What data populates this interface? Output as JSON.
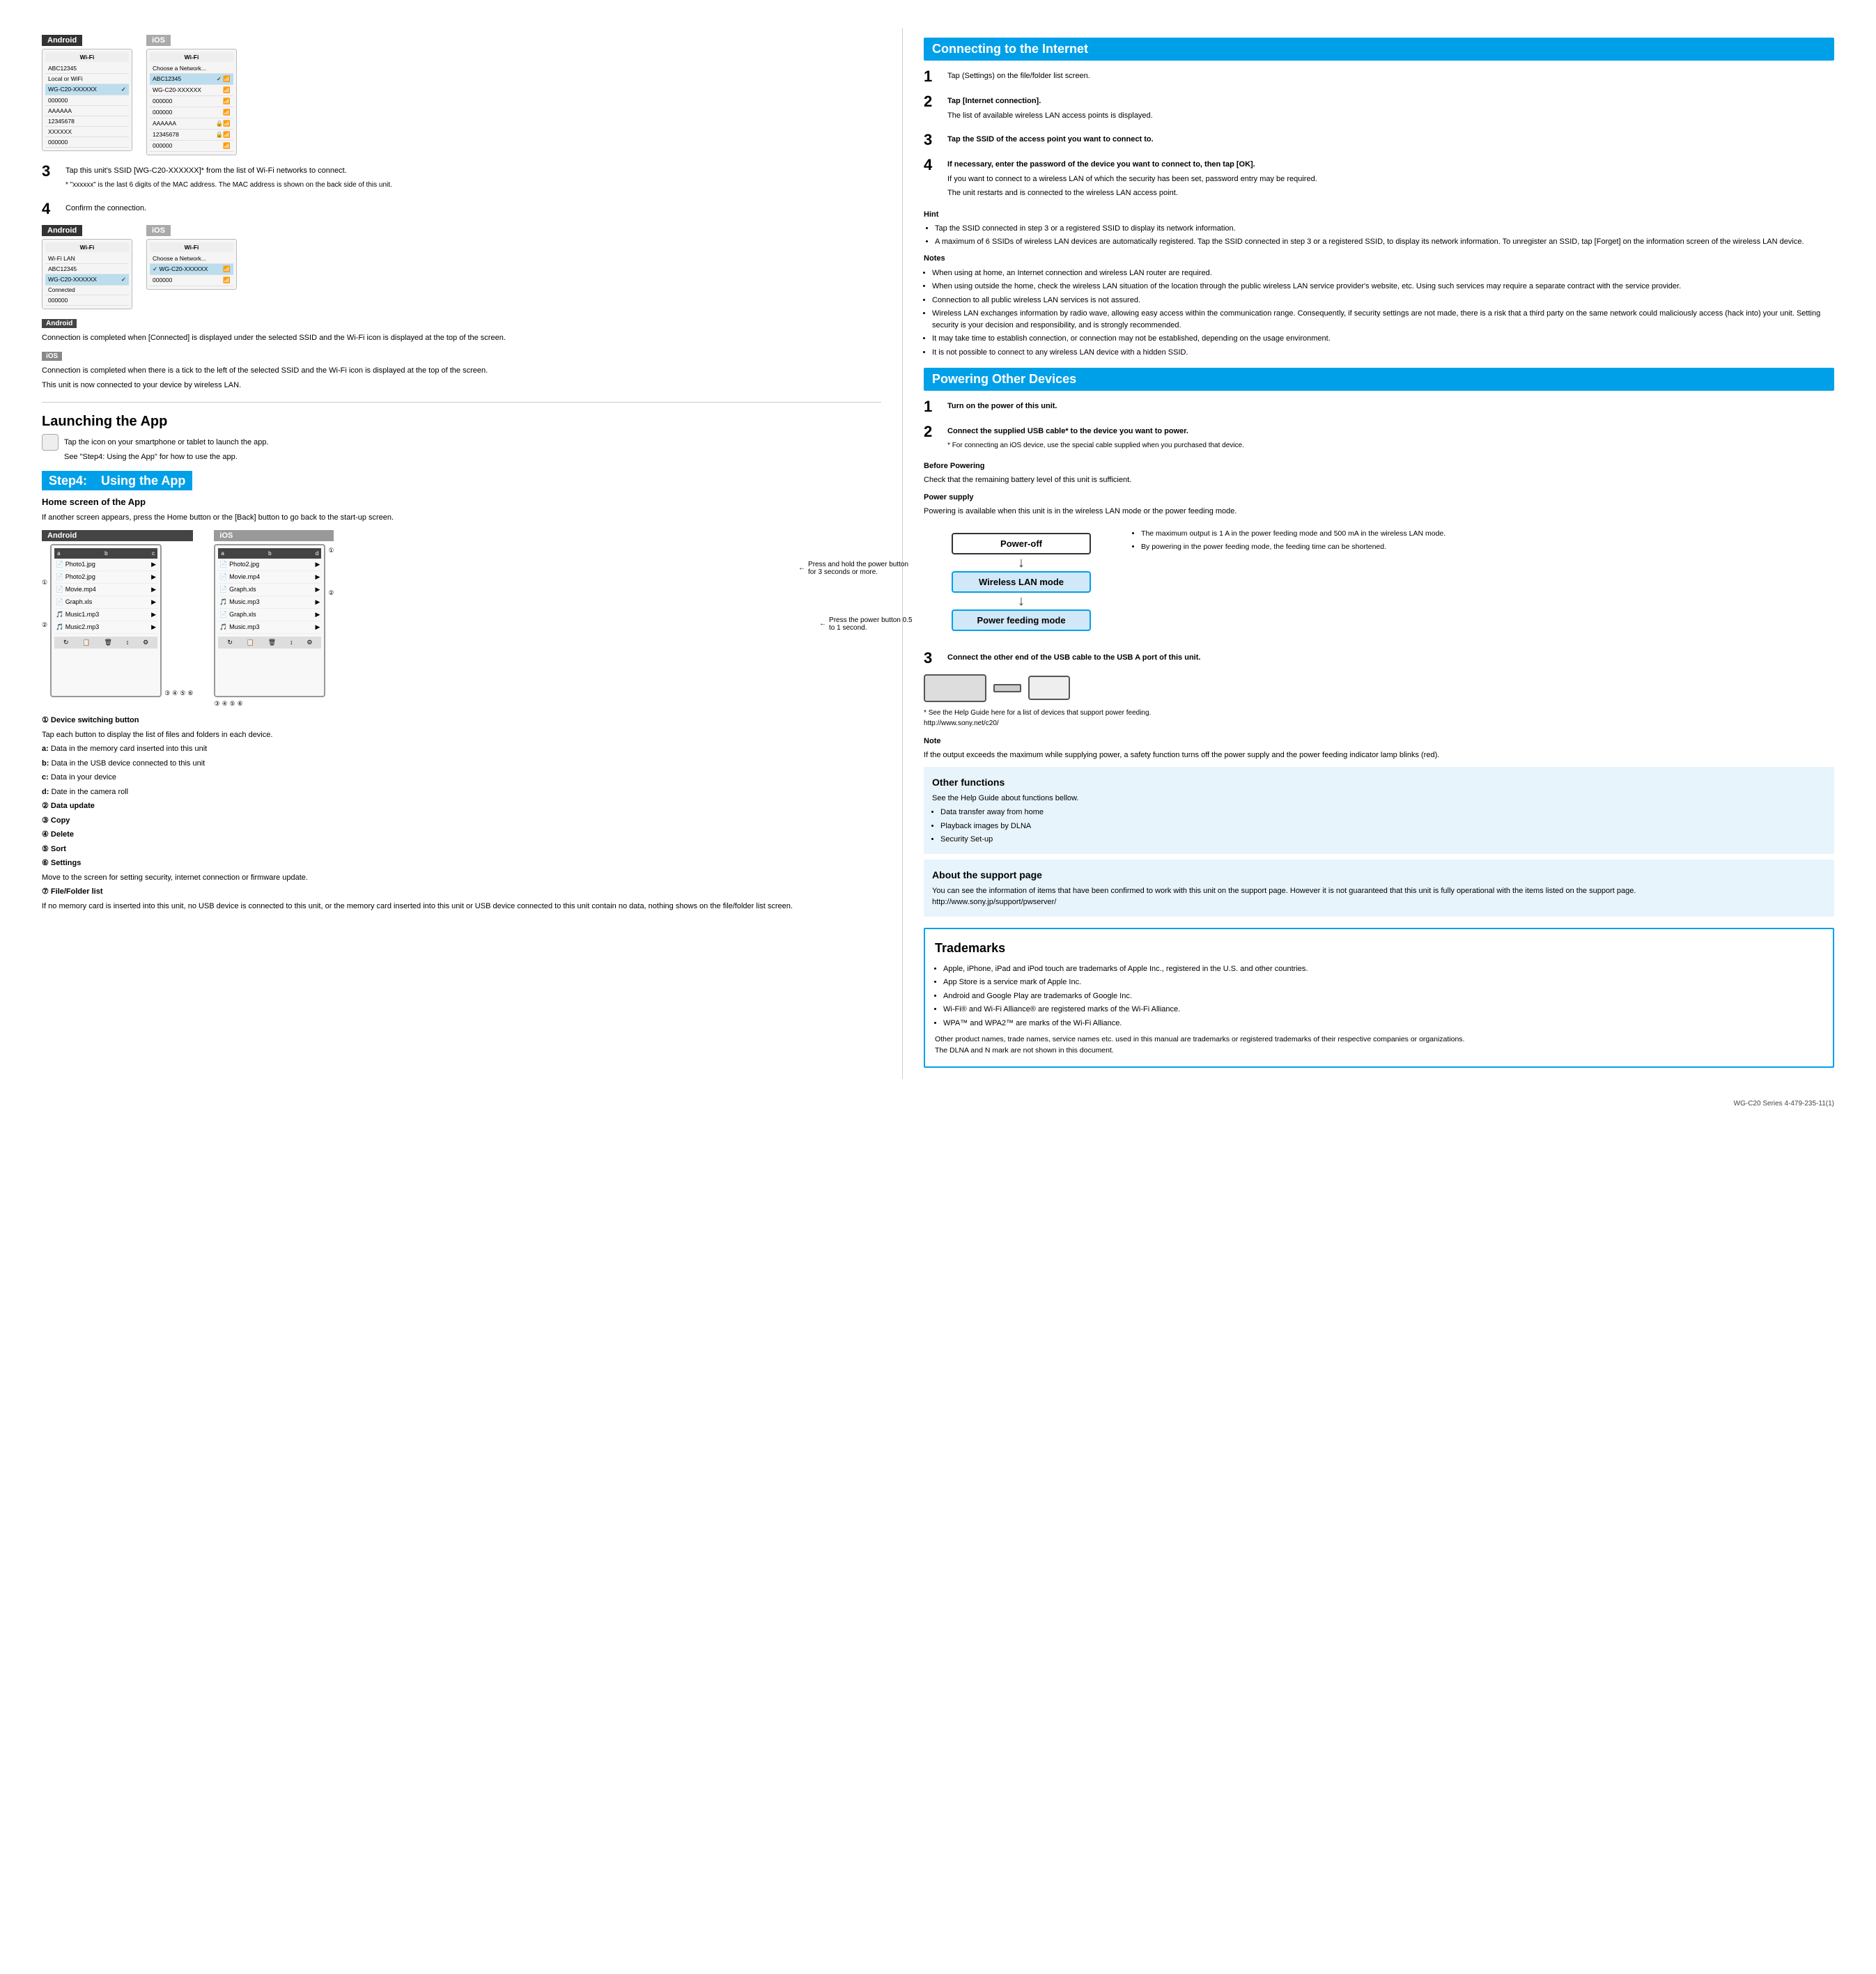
{
  "page": {
    "bottom_note": "WG-C20 Series 4-479-235-11(1)"
  },
  "left_col": {
    "step3_label": "3",
    "step3_text": "Tap this unit's SSID [WG-C20-XXXXXX]* from the list of Wi-Fi networks to connect.",
    "step3_note": "* \"xxxxxx\" is the last 6 digits of the MAC address. The MAC address is shown on the back side of this unit.",
    "step4_label": "4",
    "step4_text": "Confirm the connection.",
    "android_label": "Android",
    "ios_label": "iOS",
    "android_connection_text": "Connection is completed when [Connected] is displayed under the selected SSID and the Wi-Fi icon is displayed at the top of the screen.",
    "ios_connection_text": "Connection is completed when there is a tick to the left of the selected SSID and the Wi-Fi icon is displayed at the top of the screen.",
    "ios_connection_text2": "This unit is now connected to your device by wireless LAN.",
    "launching_header": "Launching the App",
    "launching_text": "Tap the icon on your smartphone or tablet to launch the app.",
    "launching_see": "See \"Step4: Using the App\" for how to use the app.",
    "step4_box_label": "Step4:",
    "step4_box_title": "Using the App",
    "home_screen_label": "Home screen of the App",
    "home_screen_text": "If another screen appears, press the Home button or the [Back] button to go back to the start-up screen.",
    "android_label2": "Android",
    "ios_label2": "iOS",
    "legend_items": [
      {
        "num": "①",
        "label": "Device switching button",
        "detail": "Tap each button to display the list of files and folders in each device.\na: Data in the memory card inserted into this unit\nb: Data in the USB device connected to this unit\nc: Data in your device\nd: Date in the camera roll"
      },
      {
        "num": "②",
        "label": "Data update"
      },
      {
        "num": "③",
        "label": "Copy"
      },
      {
        "num": "④",
        "label": "Delete"
      },
      {
        "num": "⑤",
        "label": "Sort"
      },
      {
        "num": "⑥",
        "label": "Settings",
        "detail": "Move to the screen for setting security, internet connection or firmware update."
      },
      {
        "num": "⑦",
        "label": "File/Folder list",
        "detail": "If no memory card is inserted into this unit, no USB device is connected to this unit, or the memory card inserted into this unit or USB device connected to this unit contain no data, nothing shows on the file/folder list screen."
      }
    ]
  },
  "right_col": {
    "connecting_header": "Connecting to the Internet",
    "step1_label": "1",
    "step1_text": "Tap (Settings) on the file/folder list screen.",
    "step2_label": "2",
    "step2_text": "Tap [Internet connection].",
    "step2_detail": "The list of available wireless LAN access points is displayed.",
    "step3_label": "3",
    "step3_text": "Tap the SSID of the access point you want to connect to.",
    "step4_label": "4",
    "step4_text": "If necessary, enter the password of the device you want to connect to, then tap [OK].",
    "step4_detail1": "If you want to connect to a wireless LAN of which the security has been set, password entry may be required.",
    "step4_detail2": "The unit restarts and is connected to the wireless LAN access point.",
    "hint_label": "Hint",
    "hint_bullets": [
      "Tap the SSID connected in step 3 or a registered SSID to display its network information.",
      "A maximum of 6 SSIDs of wireless LAN devices are automatically registered. Tap the SSID connected in step 3 or a registered SSID, to display its network information. To unregister an SSID, tap [Forget] on the information screen of the wireless LAN device."
    ],
    "notes_label": "Notes",
    "notes_bullets": [
      "When using at home, an Internet connection and wireless LAN router are required.",
      "When using outside the home, check the wireless LAN situation of the location through the public wireless LAN service provider's website, etc. Using such services may require a separate contract with the service provider.",
      "Connection to all public wireless LAN services is not assured.",
      "Wireless LAN exchanges information by radio wave, allowing easy access within the communication range. Consequently, if security settings are not made, there is a risk that a third party on the same network could maliciously access (hack into) your unit. Setting security is your decision and responsibility, and is strongly recommended.",
      "It may take time to establish connection, or connection may not be established, depending on the usage environment.",
      "It is not possible to connect to any wireless LAN device with a hidden SSID."
    ],
    "powering_header": "Powering Other Devices",
    "pow_step1_label": "1",
    "pow_step1_text": "Turn on the power of this unit.",
    "pow_step2_label": "2",
    "pow_step2_text": "Connect the supplied USB cable* to the device you want to power.",
    "pow_step2_note": "* For connecting an iOS device, use the special cable supplied when you purchased that device.",
    "before_powering_label": "Before Powering",
    "before_powering_text": "Check that the remaining battery level of this unit is sufficient.",
    "power_supply_label": "Power supply",
    "power_supply_text": "Powering is available when this unit is in the wireless LAN mode or the power feeding mode.",
    "power_diagram": {
      "box1": "Power-off",
      "box2": "Wireless LAN mode",
      "box3": "Power feeding mode",
      "arrow1": "Press and hold the power button for 3 seconds or more.",
      "arrow2": "Press the power button 0.5 to 1 second."
    },
    "power_bullets": [
      "The maximum output is 1 A in the power feeding mode and 500 mA in the wireless LAN mode.",
      "By powering in the power feeding mode, the feeding time can be shortened."
    ],
    "step3_pow_label": "3",
    "step3_pow_text": "Connect the other end of the USB cable to the USB A port of this unit.",
    "usb_note": "* See the Help Guide here for a list of devices that support power feeding.\nhttp://www.sony.net/c20/",
    "note_pow_label": "Note",
    "note_pow_text": "If the output exceeds the maximum while supplying power, a safety function turns off the power supply and the power feeding indicator lamp blinks (red).",
    "other_functions_header": "Other functions",
    "other_functions_intro": "See the Help Guide about functions bellow.",
    "other_functions_bullets": [
      "Data transfer away from home",
      "Playback images by DLNA",
      "Security Set-up"
    ],
    "support_header": "About the support page",
    "support_text": "You can see the information of items that have been confirmed to work with this unit on the support page. However it is not guaranteed that this unit is fully operational with the items listed on the support page.\nhttp://www.sony.jp/support/pwserver/",
    "trademarks_header": "Trademarks",
    "trademarks_bullets": [
      "Apple, iPhone, iPad and iPod touch are trademarks of Apple Inc., registered in the U.S. and other countries.",
      "App Store is a service mark of Apple Inc.",
      "Android and Google Play are trademarks of Google Inc.",
      "Wi-Fi® and Wi-Fi Alliance® are registered marks of the Wi-Fi Alliance.",
      "WPA™ and WPA2™ are marks of the Wi-Fi Alliance."
    ],
    "trademarks_extra": "Other product names, trade names, service names etc. used in this manual are trademarks or registered trademarks of their respective companies or organizations.\nThe DLNA and N mark are not shown in this document."
  },
  "wifi_screen": {
    "header": "Wi-Fi",
    "rows": [
      "ABC12345",
      "WG-C20-XXXXXX",
      "000000",
      "AAAAAA",
      "12345678",
      "XXXXXX",
      "000000"
    ]
  },
  "app_screen_rows_android": [
    "Photo1.jpg",
    "Photo2.jpg",
    "Movie.mp4",
    "Graph.xls",
    "Music1.mp3",
    "Music2.mp3"
  ],
  "app_screen_rows_ios": [
    "Photo2.jpg",
    "Movie.mp4",
    "Graph.xls",
    "Music.mp3",
    "Graph.xls",
    "Music.mp3"
  ]
}
